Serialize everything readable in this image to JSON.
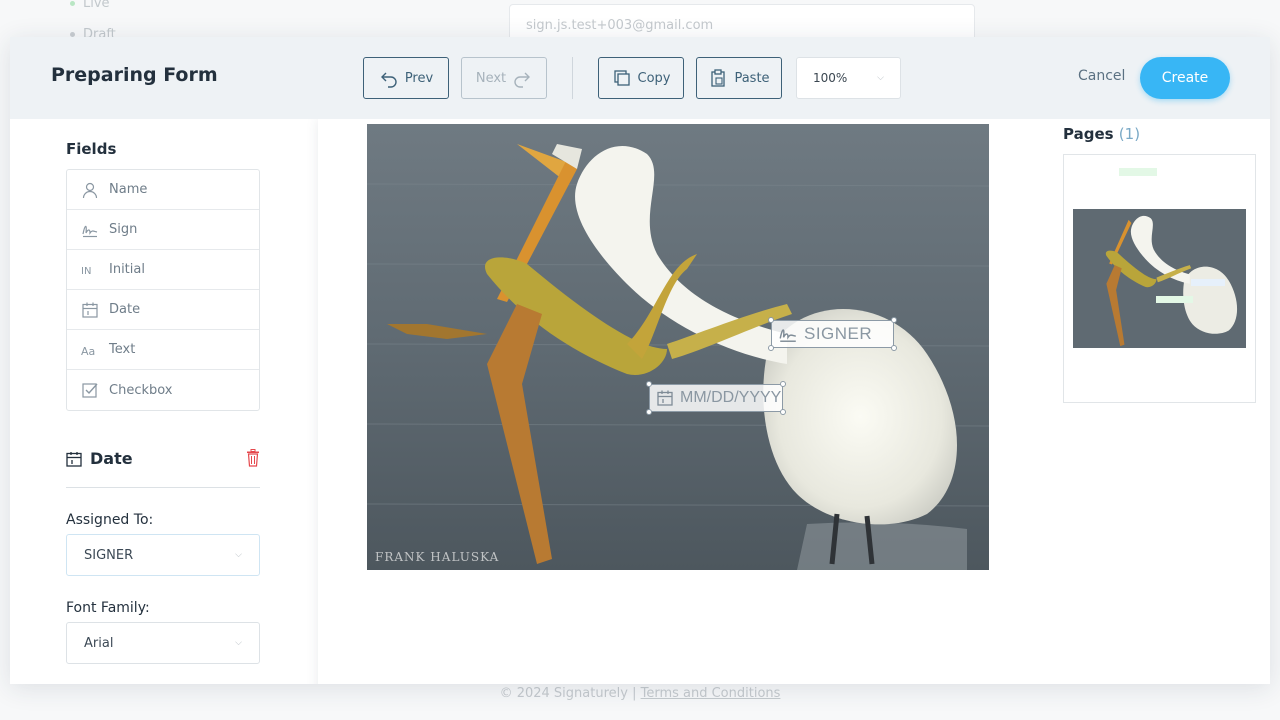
{
  "background": {
    "status_live": "Live",
    "status_draft": "Draft",
    "email_value": "sign.js.test+003@gmail.com",
    "footer_text": "© 2024 Signaturely | ",
    "footer_link": "Terms and Conditions"
  },
  "header": {
    "title": "Preparing Form",
    "prev_label": "Prev",
    "next_label": "Next",
    "copy_label": "Copy",
    "paste_label": "Paste",
    "zoom_value": "100%",
    "cancel_label": "Cancel",
    "create_label": "Create"
  },
  "fields_panel": {
    "title": "Fields",
    "items": [
      {
        "label": "Name",
        "icon": "user-icon"
      },
      {
        "label": "Sign",
        "icon": "signature-icon"
      },
      {
        "label": "Initial",
        "icon": "initials-icon"
      },
      {
        "label": "Date",
        "icon": "calendar-icon"
      },
      {
        "label": "Text",
        "icon": "text-icon"
      },
      {
        "label": "Checkbox",
        "icon": "checkbox-icon"
      }
    ]
  },
  "properties": {
    "title": "Date",
    "assigned_label": "Assigned To:",
    "assigned_value": "SIGNER",
    "font_label": "Font Family:",
    "font_value": "Arial"
  },
  "document": {
    "photo_credit": "FRANK HALUSKA",
    "signer_field_label": "SIGNER",
    "date_field_placeholder": "MM/DD/YYYY"
  },
  "pages_panel": {
    "title": "Pages",
    "count": "(1)"
  },
  "colors": {
    "accent": "#38b6f5",
    "button_border": "#3d6178",
    "delete": "#e5484d"
  }
}
